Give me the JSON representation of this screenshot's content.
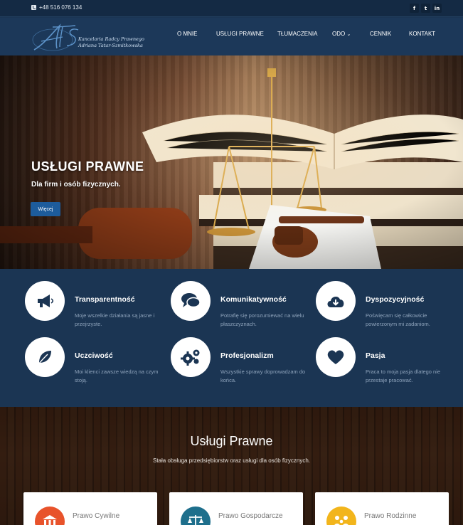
{
  "topbar": {
    "phone": "+48 516 076 134",
    "social": [
      {
        "icon": "facebook-icon",
        "glyph": "f"
      },
      {
        "icon": "twitter-icon",
        "glyph": "t"
      },
      {
        "icon": "linkedin-icon",
        "glyph": "in"
      }
    ]
  },
  "logo": {
    "monogram": "ATS",
    "line1": "Kancelaria Radcy Prawnego",
    "line2": "Adriana Tatar-Szmitkowska"
  },
  "nav": {
    "items": [
      "O MNIE",
      "USŁUGI PRAWNE",
      "TŁUMACZENIA",
      "ODO",
      "CENNIK",
      "KONTAKT"
    ]
  },
  "hero": {
    "title": "USŁUGI PRAWNE",
    "subtitle": "Dla firm i osób fizycznych.",
    "button": "Więcej"
  },
  "features": [
    {
      "icon": "megaphone-icon",
      "title": "Transparentność",
      "text": "Moje wszelkie działania są jasne i przejrzyste."
    },
    {
      "icon": "chat-bubbles-icon",
      "title": "Komunikatywność",
      "text": "Potrafię się porozumiewać na wielu płaszczyznach."
    },
    {
      "icon": "cloud-download-icon",
      "title": "Dyspozycyjność",
      "text": "Poświęcam się całkowicie powierzonym mi zadaniom."
    },
    {
      "icon": "leaf-icon",
      "title": "Uczciwość",
      "text": "Moi klienci zawsze wiedzą na czym stoją."
    },
    {
      "icon": "gears-icon",
      "title": "Profesjonalizm",
      "text": "Wszystkie sprawy doprowadzam do końca."
    },
    {
      "icon": "heart-icon",
      "title": "Pasja",
      "text": "Praca to moja pasja dlatego nie przestaje pracować."
    }
  ],
  "services": {
    "title": "Usługi Prawne",
    "subtitle": "Stała obsługa przedsiębiorstw oraz usługi dla osób fizycznych.",
    "cards": [
      {
        "icon": "courthouse-icon",
        "title": "Prawo Cywilne",
        "color": "#e8532b"
      },
      {
        "icon": "scales-icon",
        "title": "Prawo Gospodarcze",
        "color": "#1e6f8c"
      },
      {
        "icon": "family-icon",
        "title": "Prawo Rodzinne",
        "color": "#f2b51c"
      }
    ]
  },
  "colors": {
    "navy": "#1b3553",
    "accent_button": "#1d5c9c"
  }
}
